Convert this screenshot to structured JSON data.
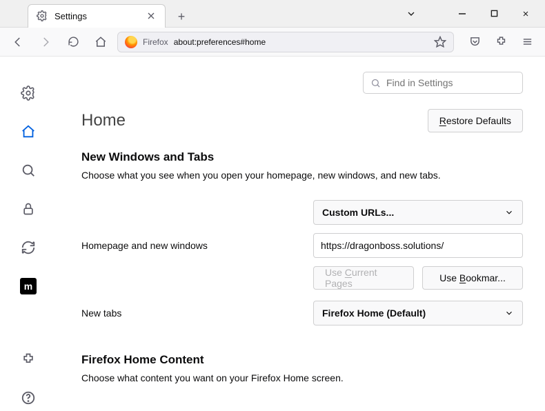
{
  "tab": {
    "title": "Settings"
  },
  "urlbar": {
    "identity_label": "Firefox",
    "url": "about:preferences#home"
  },
  "search": {
    "placeholder": "Find in Settings"
  },
  "page": {
    "title": "Home",
    "restore_defaults": "Restore Defaults",
    "restore_defaults_underline": "R"
  },
  "new_windows_tabs": {
    "heading": "New Windows and Tabs",
    "description": "Choose what you see when you open your homepage, new windows, and new tabs.",
    "homepage_label": "Homepage and new windows",
    "homepage_select": "Custom URLs...",
    "homepage_value": "https://dragonboss.solutions/",
    "use_current_pages": "Use Current Pages",
    "use_current_underline": "C",
    "use_bookmark": "Use Bookmar...",
    "use_bookmark_underline": "B",
    "newtabs_label": "New tabs",
    "newtabs_select": "Firefox Home (Default)"
  },
  "home_content": {
    "heading": "Firefox Home Content",
    "description": "Choose what content you want on your Firefox Home screen."
  },
  "sidebar": {
    "items": [
      {
        "name": "general",
        "icon": "gear"
      },
      {
        "name": "home",
        "icon": "home",
        "active": true
      },
      {
        "name": "search",
        "icon": "search"
      },
      {
        "name": "privacy",
        "icon": "lock"
      },
      {
        "name": "sync",
        "icon": "sync"
      },
      {
        "name": "mozilla",
        "icon": "mozilla"
      }
    ],
    "bottom": [
      {
        "name": "extensions",
        "icon": "puzzle"
      },
      {
        "name": "help",
        "icon": "help"
      }
    ]
  }
}
